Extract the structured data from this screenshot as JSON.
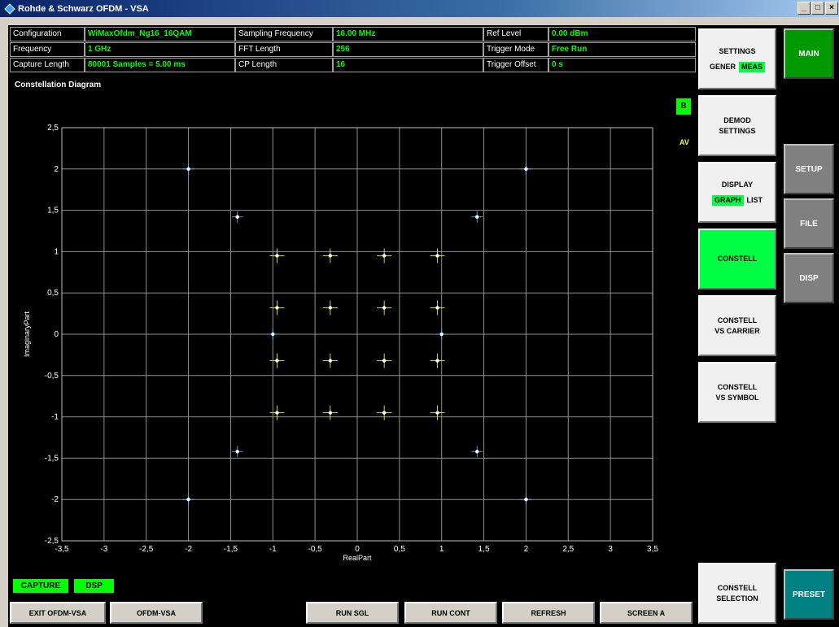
{
  "window": {
    "title": "Rohde & Schwarz OFDM - VSA",
    "controls": [
      "_",
      "□",
      "×"
    ]
  },
  "info": {
    "configuration_label": "Configuration",
    "configuration_value": "WiMaxOfdm_Ng16_16QAM",
    "frequency_label": "Frequency",
    "frequency_value": "1 GHz",
    "capture_length_label": "Capture Length",
    "capture_length_value": "80001 Samples = 5.00 ms",
    "sampling_frequency_label": "Sampling Frequency",
    "sampling_frequency_value": "16.00 MHz",
    "fft_length_label": "FFT Length",
    "fft_length_value": "256",
    "cp_length_label": "CP Length",
    "cp_length_value": "16",
    "ref_level_label": "Ref Level",
    "ref_level_value": "0.00 dBm",
    "trigger_mode_label": "Trigger Mode",
    "trigger_mode_value": "Free Run",
    "trigger_offset_label": "Trigger Offset",
    "trigger_offset_value": "0 s"
  },
  "plot": {
    "title": "Constellation Diagram",
    "badge_b": "B",
    "badge_av": "AV"
  },
  "chart_data": {
    "type": "scatter",
    "title": "Constellation Diagram",
    "xlabel": "RealPart",
    "ylabel": "ImaginaryPart",
    "xlim": [
      -3.5,
      3.5
    ],
    "ylim": [
      -2.5,
      2.5
    ],
    "xticks": [
      "-3,5",
      "-3",
      "-2,5",
      "-2",
      "-1,5",
      "-1",
      "-0,5",
      "0",
      "0,5",
      "1",
      "1,5",
      "2",
      "2,5",
      "3",
      "3,5"
    ],
    "yticks": [
      "2,5",
      "2",
      "1,5",
      "1",
      "0,5",
      "0",
      "-0,5",
      "-1",
      "-1,5",
      "-2",
      "-2,5"
    ],
    "grid": true,
    "series": [
      {
        "color": "#ffff00",
        "points": [
          [
            -0.95,
            0.95
          ],
          [
            -0.32,
            0.95
          ],
          [
            0.32,
            0.95
          ],
          [
            0.95,
            0.95
          ],
          [
            -0.95,
            0.32
          ],
          [
            -0.32,
            0.32
          ],
          [
            0.32,
            0.32
          ],
          [
            0.95,
            0.32
          ],
          [
            -0.95,
            -0.32
          ],
          [
            -0.32,
            -0.32
          ],
          [
            0.32,
            -0.32
          ],
          [
            0.95,
            -0.32
          ],
          [
            -0.95,
            -0.95
          ],
          [
            -0.32,
            -0.95
          ],
          [
            0.32,
            -0.95
          ],
          [
            0.95,
            -0.95
          ]
        ]
      },
      {
        "color": "#40c0ff",
        "points": [
          [
            -2,
            2
          ],
          [
            2,
            2
          ],
          [
            -1.42,
            1.42
          ],
          [
            1.42,
            1.42
          ],
          [
            -1,
            0
          ],
          [
            1,
            0
          ],
          [
            -1.42,
            -1.42
          ],
          [
            1.42,
            -1.42
          ],
          [
            -2,
            -2
          ],
          [
            2,
            -2
          ]
        ]
      }
    ]
  },
  "softkeys": {
    "settings": "SETTINGS",
    "settings_gener": "GENER",
    "settings_meas": "MEAS",
    "demod_line1": "DEMOD",
    "demod_line2": "SETTINGS",
    "display": "DISPLAY",
    "display_graph": "GRAPH",
    "display_list": "LIST",
    "constell": "CONSTELL",
    "constell_carrier_line1": "CONSTELL",
    "constell_carrier_line2": "VS CARRIER",
    "constell_symbol_line1": "CONSTELL",
    "constell_symbol_line2": "VS SYMBOL",
    "constell_selection_line1": "CONSTELL",
    "constell_selection_line2": "SELECTION"
  },
  "hardkeys": {
    "main": "MAIN",
    "setup": "SETUP",
    "file": "FILE",
    "disp": "DISP",
    "preset": "PRESET"
  },
  "status": {
    "capture": "CAPTURE",
    "dsp": "DSP"
  },
  "bottom_buttons": {
    "exit": "EXIT OFDM-VSA",
    "ofdm": "OFDM-VSA",
    "run_sgl": "RUN SGL",
    "run_cont": "RUN CONT",
    "refresh": "REFRESH",
    "screen_a": "SCREEN A"
  },
  "colors": {
    "accent_green": "#00ff44",
    "hard_green": "#009900",
    "hard_gray": "#808080",
    "preset_teal": "#008080"
  }
}
